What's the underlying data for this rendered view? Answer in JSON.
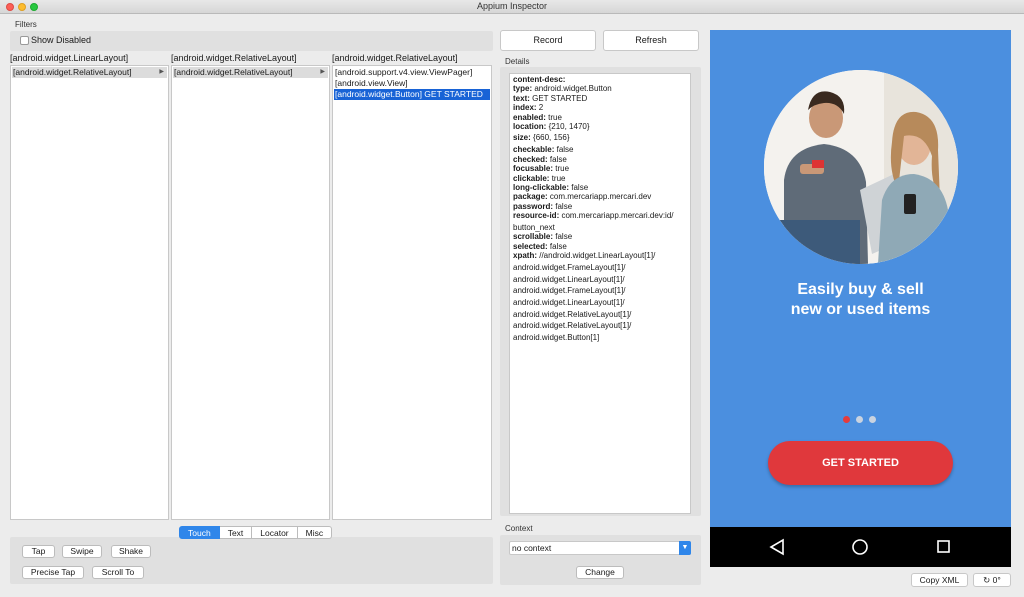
{
  "window": {
    "title": "Appium Inspector"
  },
  "filters": {
    "label": "Filters",
    "show_disabled": "Show Disabled"
  },
  "hierarchy": {
    "columns": [
      {
        "header": "[android.widget.LinearLayout]",
        "items": [
          "[android.widget.RelativeLayout]"
        ]
      },
      {
        "header": "[android.widget.RelativeLayout]",
        "items": [
          "[android.widget.RelativeLayout]"
        ]
      },
      {
        "header": "[android.widget.RelativeLayout]",
        "items": [
          "[android.support.v4.view.ViewPager]",
          "[android.view.View]",
          "[android.widget.Button] GET STARTED"
        ]
      }
    ]
  },
  "actions": {
    "tabs": [
      "Touch",
      "Text",
      "Locator",
      "Misc"
    ],
    "active_tab": "Touch",
    "buttons": [
      "Tap",
      "Swipe",
      "Shake",
      "Precise Tap",
      "Scroll To"
    ]
  },
  "toolbar": {
    "record": "Record",
    "refresh": "Refresh"
  },
  "details": {
    "label": "Details",
    "lines": [
      {
        "key": "content-desc:",
        "value": ""
      },
      {
        "key": "type:",
        "value": "android.widget.Button"
      },
      {
        "key": "text:",
        "value": "GET STARTED"
      },
      {
        "key": "index:",
        "value": "2"
      },
      {
        "key": "enabled:",
        "value": "true"
      },
      {
        "key": "location:",
        "value": "{210, 1470}"
      },
      {
        "key": "size:",
        "value": "{660, 156}"
      },
      {
        "key": "checkable:",
        "value": "false"
      },
      {
        "key": "checked:",
        "value": "false"
      },
      {
        "key": "focusable:",
        "value": "true"
      },
      {
        "key": "clickable:",
        "value": "true"
      },
      {
        "key": "long-clickable:",
        "value": "false"
      },
      {
        "key": "package:",
        "value": "com.mercariapp.mercari.dev"
      },
      {
        "key": "password:",
        "value": "false"
      },
      {
        "key": "resource-id:",
        "value": "com.mercariapp.mercari.dev:id/"
      },
      {
        "key": "",
        "value": "button_next"
      },
      {
        "key": "scrollable:",
        "value": "false"
      },
      {
        "key": "selected:",
        "value": "false"
      },
      {
        "key": "xpath:",
        "value": "//android.widget.LinearLayout[1]/"
      },
      {
        "key": "",
        "value": "android.widget.FrameLayout[1]/"
      },
      {
        "key": "",
        "value": "android.widget.LinearLayout[1]/"
      },
      {
        "key": "",
        "value": "android.widget.FrameLayout[1]/"
      },
      {
        "key": "",
        "value": "android.widget.LinearLayout[1]/"
      },
      {
        "key": "",
        "value": "android.widget.RelativeLayout[1]/"
      },
      {
        "key": "",
        "value": "android.widget.RelativeLayout[1]/"
      },
      {
        "key": "",
        "value": "android.widget.Button[1]"
      }
    ]
  },
  "context": {
    "label": "Context",
    "selected": "no context",
    "change": "Change"
  },
  "device": {
    "headline_line1": "Easily buy & sell",
    "headline_line2": "new or used items",
    "cta": "GET STARTED",
    "page_indicator": {
      "count": 3,
      "active": 1
    },
    "colors": {
      "background": "#4b8fdf",
      "cta": "#e0383c",
      "active_dot": "#e53b3b"
    }
  },
  "footer": {
    "copy_xml": "Copy XML",
    "rotation": "0°"
  }
}
